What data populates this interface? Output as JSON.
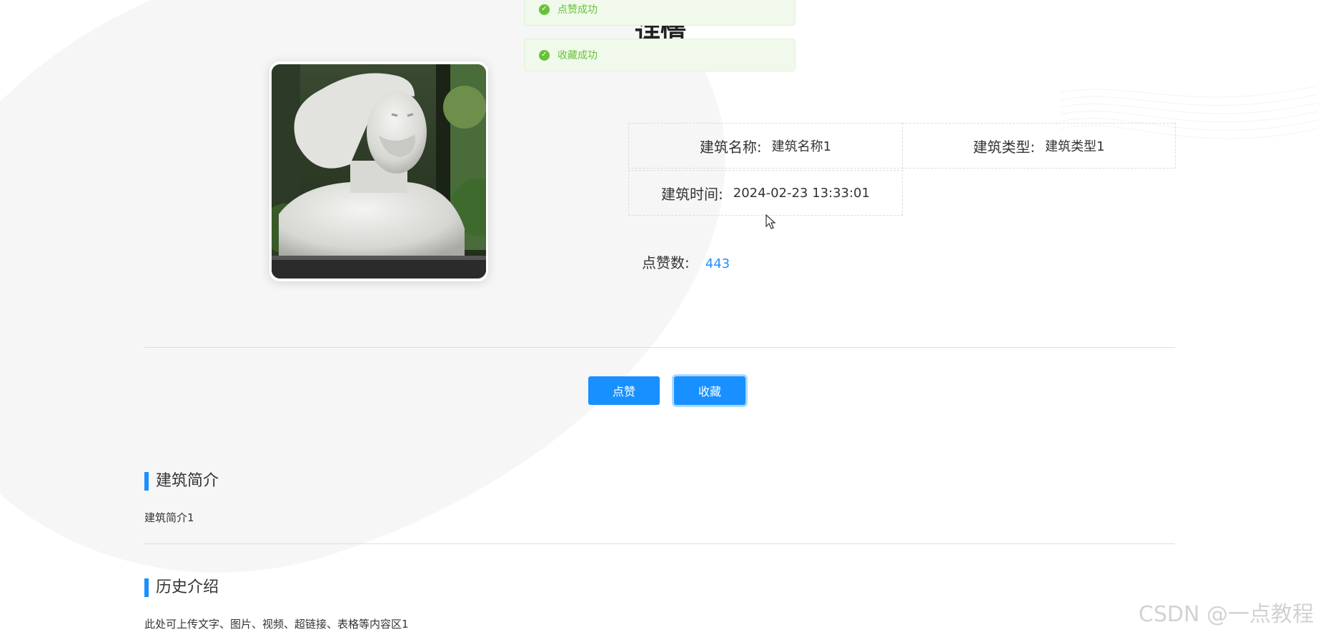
{
  "page": {
    "heading": "详情"
  },
  "toasts": [
    {
      "text": "点赞成功",
      "status_color": "#67c23a"
    },
    {
      "text": "收藏成功",
      "status_color": "#67c23a"
    }
  ],
  "details": {
    "name": {
      "label": "建筑名称:",
      "value": "建筑名称1"
    },
    "type": {
      "label": "建筑类型:",
      "value": "建筑类型1"
    },
    "time": {
      "label": "建筑时间:",
      "value": "2024-02-23 13:33:01"
    },
    "likes": {
      "label": "点赞数:",
      "value": "443"
    }
  },
  "actions": {
    "like_label": "点赞",
    "favorite_label": "收藏"
  },
  "sections": [
    {
      "title": "建筑简介",
      "body": "建筑简介1"
    },
    {
      "title": "历史介绍",
      "body": "此处可上传文字、图片、视频、超链接、表格等内容区1"
    }
  ],
  "watermark": "CSDN @一点教程",
  "colors": {
    "accent": "#1890ff",
    "likes_value": "#1e90ff",
    "success": "#67c23a"
  },
  "icons": {
    "toast": "check-circle-icon",
    "cursor": "mouse-pointer-icon"
  }
}
